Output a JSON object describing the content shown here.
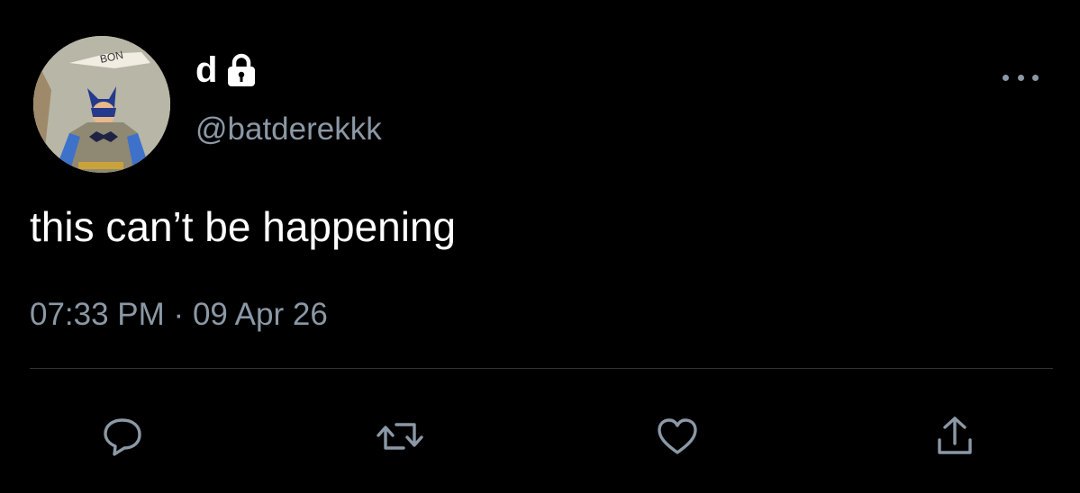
{
  "user": {
    "display_name": "d",
    "handle": "@batderekkk",
    "protected_icon": "lock-icon",
    "avatar_icon": "batman-comic-avatar"
  },
  "tweet": {
    "text": "this can’t be happening",
    "time": "07:33 PM",
    "separator": "·",
    "date": "09 Apr 26"
  },
  "avatar_text": "BON",
  "actions": {
    "reply_icon": "reply-icon",
    "retweet_icon": "retweet-icon",
    "like_icon": "heart-icon",
    "share_icon": "share-icon",
    "more_icon": "more-dots-icon"
  },
  "colors": {
    "background": "#000000",
    "primary_text": "#ffffff",
    "secondary_text": "#8b98a5",
    "divider": "#2f3336"
  }
}
